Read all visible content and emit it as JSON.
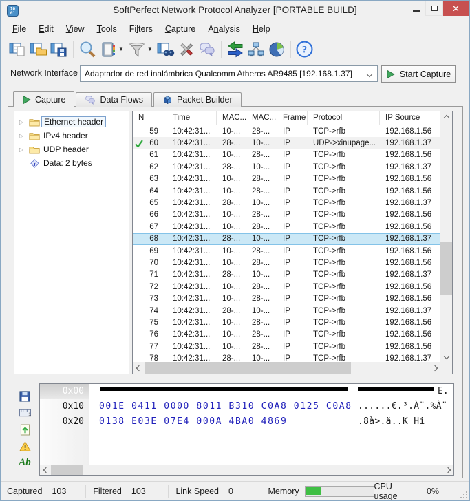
{
  "window": {
    "title": "SoftPerfect Network Protocol Analyzer [PORTABLE BUILD]",
    "icon_top": "10",
    "icon_bottom": "01"
  },
  "menu": {
    "items": [
      {
        "label": "File",
        "pre": "",
        "key": "F",
        "post": "ile"
      },
      {
        "label": "Edit",
        "pre": "",
        "key": "E",
        "post": "dit"
      },
      {
        "label": "View",
        "pre": "",
        "key": "V",
        "post": "iew"
      },
      {
        "label": "Tools",
        "pre": "",
        "key": "T",
        "post": "ools"
      },
      {
        "label": "Filters",
        "pre": "Fi",
        "key": "l",
        "post": "ters"
      },
      {
        "label": "Capture",
        "pre": "",
        "key": "C",
        "post": "apture"
      },
      {
        "label": "Analysis",
        "pre": "A",
        "key": "n",
        "post": "alysis"
      },
      {
        "label": "Help",
        "pre": "",
        "key": "H",
        "post": "elp"
      }
    ]
  },
  "toolbar": {
    "icons": [
      "new-capture",
      "open-capture",
      "save-capture",
      "search",
      "address-book",
      "filter",
      "find-packets",
      "settings",
      "data-flows",
      "traffic-arrows",
      "network-nodes",
      "pie-chart",
      "help"
    ]
  },
  "interface_bar": {
    "label": "Network Interface",
    "value": "Adaptador de red inalámbrica Qualcomm Atheros AR9485 [192.168.1.37]",
    "start": {
      "pre": "",
      "key": "S",
      "post": "tart Capture"
    }
  },
  "tabs": [
    {
      "label": "Capture",
      "active": true
    },
    {
      "label": "Data Flows",
      "active": false
    },
    {
      "label": "Packet Builder",
      "active": false
    }
  ],
  "tree": {
    "items": [
      {
        "label": "Ethernet header",
        "icon": "folder",
        "selected": true
      },
      {
        "label": "IPv4 header",
        "icon": "folder",
        "selected": false
      },
      {
        "label": "UDP header",
        "icon": "folder",
        "selected": false
      },
      {
        "label": "Data: 2 bytes",
        "icon": "info",
        "selected": false
      }
    ]
  },
  "packet_table": {
    "columns": [
      "N",
      "Time",
      "MAC...",
      "MAC...",
      "Frame",
      "Protocol",
      "IP Source"
    ],
    "rows": [
      {
        "n": "59",
        "time": "10:42:31...",
        "mac_dst": "10-...",
        "mac_src": "28-...",
        "frame": "IP",
        "protocol": "TCP->rfb",
        "ip_source": "192.168.1.56",
        "checked": false,
        "state": "normal"
      },
      {
        "n": "60",
        "time": "10:42:31...",
        "mac_dst": "28-...",
        "mac_src": "10-...",
        "frame": "IP",
        "protocol": "UDP->xinupage...",
        "ip_source": "192.168.1.37",
        "checked": true,
        "state": "muted"
      },
      {
        "n": "61",
        "time": "10:42:31...",
        "mac_dst": "10-...",
        "mac_src": "28-...",
        "frame": "IP",
        "protocol": "TCP->rfb",
        "ip_source": "192.168.1.56",
        "checked": false,
        "state": "normal"
      },
      {
        "n": "62",
        "time": "10:42:31...",
        "mac_dst": "28-...",
        "mac_src": "10-...",
        "frame": "IP",
        "protocol": "TCP->rfb",
        "ip_source": "192.168.1.37",
        "checked": false,
        "state": "normal"
      },
      {
        "n": "63",
        "time": "10:42:31...",
        "mac_dst": "10-...",
        "mac_src": "28-...",
        "frame": "IP",
        "protocol": "TCP->rfb",
        "ip_source": "192.168.1.56",
        "checked": false,
        "state": "normal"
      },
      {
        "n": "64",
        "time": "10:42:31...",
        "mac_dst": "10-...",
        "mac_src": "28-...",
        "frame": "IP",
        "protocol": "TCP->rfb",
        "ip_source": "192.168.1.56",
        "checked": false,
        "state": "normal"
      },
      {
        "n": "65",
        "time": "10:42:31...",
        "mac_dst": "28-...",
        "mac_src": "10-...",
        "frame": "IP",
        "protocol": "TCP->rfb",
        "ip_source": "192.168.1.37",
        "checked": false,
        "state": "normal"
      },
      {
        "n": "66",
        "time": "10:42:31...",
        "mac_dst": "10-...",
        "mac_src": "28-...",
        "frame": "IP",
        "protocol": "TCP->rfb",
        "ip_source": "192.168.1.56",
        "checked": false,
        "state": "normal"
      },
      {
        "n": "67",
        "time": "10:42:31...",
        "mac_dst": "10-...",
        "mac_src": "28-...",
        "frame": "IP",
        "protocol": "TCP->rfb",
        "ip_source": "192.168.1.56",
        "checked": false,
        "state": "normal"
      },
      {
        "n": "68",
        "time": "10:42:31...",
        "mac_dst": "28-...",
        "mac_src": "10-...",
        "frame": "IP",
        "protocol": "TCP->rfb",
        "ip_source": "192.168.1.37",
        "checked": false,
        "state": "selected"
      },
      {
        "n": "69",
        "time": "10:42:31...",
        "mac_dst": "10-...",
        "mac_src": "28-...",
        "frame": "IP",
        "protocol": "TCP->rfb",
        "ip_source": "192.168.1.56",
        "checked": false,
        "state": "normal"
      },
      {
        "n": "70",
        "time": "10:42:31...",
        "mac_dst": "10-...",
        "mac_src": "28-...",
        "frame": "IP",
        "protocol": "TCP->rfb",
        "ip_source": "192.168.1.56",
        "checked": false,
        "state": "normal"
      },
      {
        "n": "71",
        "time": "10:42:31...",
        "mac_dst": "28-...",
        "mac_src": "10-...",
        "frame": "IP",
        "protocol": "TCP->rfb",
        "ip_source": "192.168.1.37",
        "checked": false,
        "state": "normal"
      },
      {
        "n": "72",
        "time": "10:42:31...",
        "mac_dst": "10-...",
        "mac_src": "28-...",
        "frame": "IP",
        "protocol": "TCP->rfb",
        "ip_source": "192.168.1.56",
        "checked": false,
        "state": "normal"
      },
      {
        "n": "73",
        "time": "10:42:31...",
        "mac_dst": "10-...",
        "mac_src": "28-...",
        "frame": "IP",
        "protocol": "TCP->rfb",
        "ip_source": "192.168.1.56",
        "checked": false,
        "state": "normal"
      },
      {
        "n": "74",
        "time": "10:42:31...",
        "mac_dst": "28-...",
        "mac_src": "10-...",
        "frame": "IP",
        "protocol": "TCP->rfb",
        "ip_source": "192.168.1.37",
        "checked": false,
        "state": "normal"
      },
      {
        "n": "75",
        "time": "10:42:31...",
        "mac_dst": "10-...",
        "mac_src": "28-...",
        "frame": "IP",
        "protocol": "TCP->rfb",
        "ip_source": "192.168.1.56",
        "checked": false,
        "state": "normal"
      },
      {
        "n": "76",
        "time": "10:42:31...",
        "mac_dst": "10-...",
        "mac_src": "28-...",
        "frame": "IP",
        "protocol": "TCP->rfb",
        "ip_source": "192.168.1.56",
        "checked": false,
        "state": "normal"
      },
      {
        "n": "77",
        "time": "10:42:31...",
        "mac_dst": "10-...",
        "mac_src": "28-...",
        "frame": "IP",
        "protocol": "TCP->rfb",
        "ip_source": "192.168.1.56",
        "checked": false,
        "state": "normal"
      },
      {
        "n": "78",
        "time": "10:42:31...",
        "mac_dst": "28-...",
        "mac_src": "10-...",
        "frame": "IP",
        "protocol": "TCP->rfb",
        "ip_source": "192.168.1.37",
        "checked": false,
        "state": "normal"
      }
    ]
  },
  "hex_panel": {
    "side_icons": [
      "save-dump",
      "ruler",
      "export-up",
      "warning",
      "font"
    ],
    "rows": [
      {
        "addr": "0x00",
        "hex": "",
        "ascii": "E.",
        "redacted": true,
        "selected": true
      },
      {
        "addr": "0x10",
        "hex": "001E 0411 0000 8011 B310 C0A8 0125 C0A8",
        "ascii": "......€.³.À¨.%À¨",
        "redacted": false,
        "selected": false
      },
      {
        "addr": "0x20",
        "hex": "0138 E03E 07E4 000A 4BA0 4869",
        "ascii": ".8à>.ä..K Hi",
        "redacted": false,
        "selected": false
      }
    ]
  },
  "status": {
    "captured_label": "Captured",
    "captured_value": "103",
    "filtered_label": "Filtered",
    "filtered_value": "103",
    "link_label": "Link Speed",
    "link_value": "0",
    "memory_label": "Memory",
    "memory_percent": 22,
    "cpu_label": "CPU usage",
    "cpu_value": "0%"
  },
  "colors": {
    "close_button": "#c75050",
    "selection_row": "#cbe8f6",
    "check_green": "#2faa3e",
    "hex_blue": "#2121bb",
    "memory_green": "#3fbf44",
    "folder_yellow": "#fbe28a"
  }
}
